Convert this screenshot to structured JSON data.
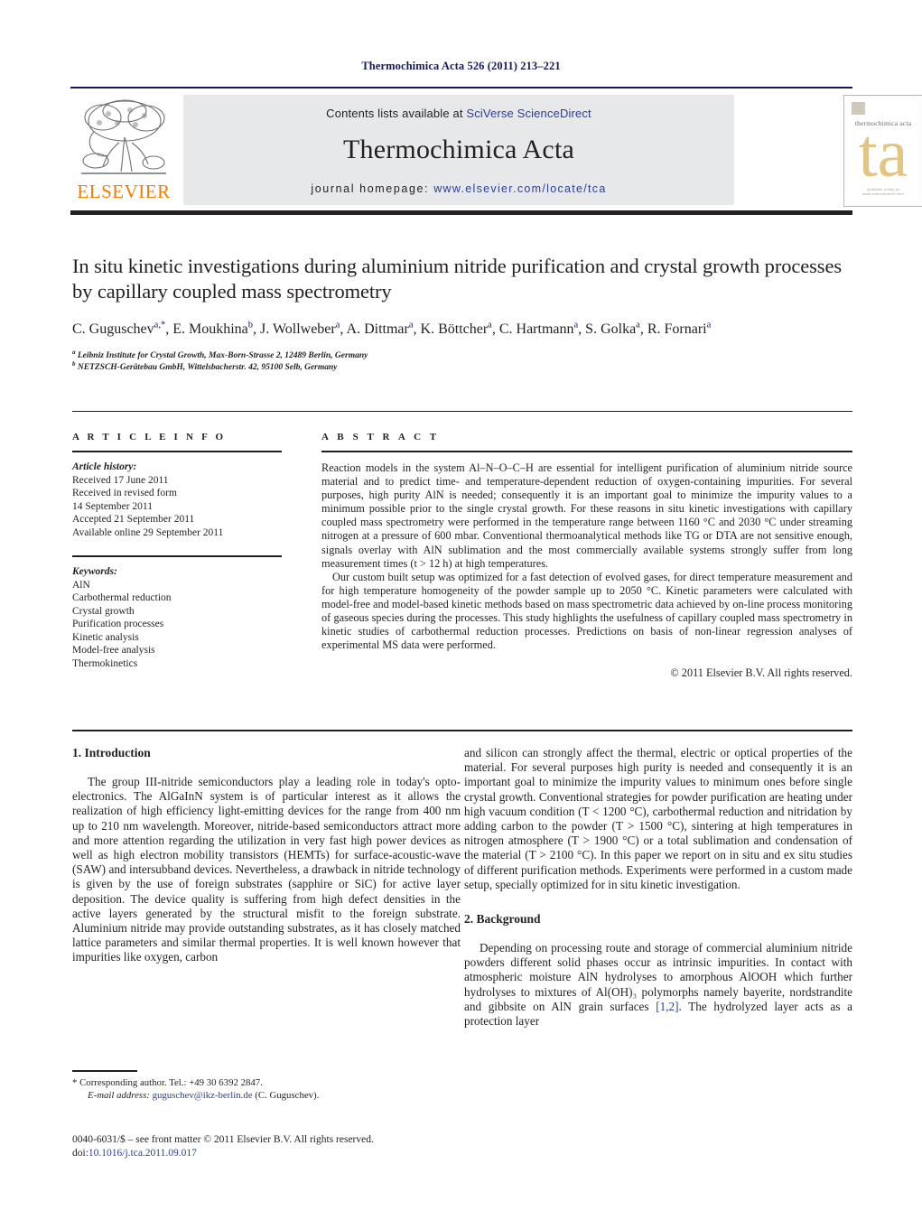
{
  "masthead": "Thermochimica Acta 526 (2011) 213–221",
  "header": {
    "publisher_name": "ELSEVIER",
    "contents_prefix": "Contents lists available at ",
    "contents_link": "SciVerse ScienceDirect",
    "journal_title": "Thermochimica Acta",
    "homepage_label": "journal homepage: ",
    "homepage_url": "www.elsevier.com/locate/tca",
    "cover_journal_name": "thermochimica acta",
    "cover_logo_text": "ta",
    "cover_footer": "available online at www.sciencedirect.com",
    "link_color": "#2b3f93",
    "rule_color": "#14195a",
    "gray_box_color": "#e7e8ea",
    "elsevier_orange": "#f07d00"
  },
  "article": {
    "title": "In situ kinetic investigations during aluminium nitride purification and crystal growth processes by capillary coupled mass spectrometry",
    "authors_line1": "C. Guguschev",
    "authors_html": "C. Guguschev<sup>a,*</sup>, E. Moukhina<sup>b</sup>, J. Wollweber<sup>a</sup>, A. Dittmar<sup>a</sup>, K. Böttcher<sup>a</sup>, C. Hartmann<sup>a</sup>, S. Golka<sup>a</sup>, R. Fornari<sup>a</sup>",
    "affiliation_a": "Leibniz Institute for Crystal Growth, Max-Born-Strasse 2, 12489 Berlin, Germany",
    "affiliation_b": "NETZSCH-Gerätebau GmbH, Wittelsbacherstr. 42, 95100 Selb, Germany"
  },
  "article_info": {
    "heading": "A R T I C L E  I N F O",
    "history_label": "Article history:",
    "history": [
      "Received 17 June 2011",
      "Received in revised form",
      "14 September 2011",
      "Accepted 21 September 2011",
      "Available online 29 September 2011"
    ],
    "keywords_label": "Keywords:",
    "keywords": [
      "AlN",
      "Carbothermal reduction",
      "Crystal growth",
      "Purification processes",
      "Kinetic analysis",
      "Model-free analysis",
      "Thermokinetics"
    ]
  },
  "abstract": {
    "heading": "A B S T R A C T",
    "paragraph1": "Reaction models in the system Al–N–O–C–H are essential for intelligent purification of aluminium nitride source material and to predict time- and temperature-dependent reduction of oxygen-containing impurities. For several purposes, high purity AlN is needed; consequently it is an important goal to minimize the impurity values to a minimum possible prior to the single crystal growth. For these reasons in situ kinetic investigations with capillary coupled mass spectrometry were performed in the temperature range between 1160 °C and 2030 °C under streaming nitrogen at a pressure of 600 mbar. Conventional thermoanalytical methods like TG or DTA are not sensitive enough, signals overlay with AlN sublimation and the most commercially available systems strongly suffer from long measurement times (t > 12 h) at high temperatures.",
    "paragraph2": "Our custom built setup was optimized for a fast detection of evolved gases, for direct temperature measurement and for high temperature homogeneity of the powder sample up to 2050 °C. Kinetic parameters were calculated with model-free and model-based kinetic methods based on mass spectrometric data achieved by on-line process monitoring of gaseous species during the processes. This study highlights the usefulness of capillary coupled mass spectrometry in kinetic studies of carbothermal reduction processes. Predictions on basis of non-linear regression analyses of experimental MS data were performed.",
    "copyright": "© 2011 Elsevier B.V. All rights reserved."
  },
  "body": {
    "section1_heading": "1.  Introduction",
    "section1_p1": "The group III-nitride semiconductors play a leading role in today's opto-electronics. The AlGaInN system is of particular interest as it allows the realization of high efficiency light-emitting devices for the range from 400 nm up to 210 nm wavelength. Moreover, nitride-based semiconductors attract more and more attention regarding the utilization in very fast high power devices as well as high electron mobility transistors (HEMTs) for surface-acoustic-wave (SAW) and intersubband devices. Nevertheless, a drawback in nitride technology is given by the use of foreign substrates (sapphire or SiC) for active layer deposition. The device quality is suffering from high defect densities in the active layers generated by the structural misfit to the foreign substrate. Aluminium nitride may provide outstanding substrates, as it has closely matched lattice parameters and similar thermal properties. It is well known however that impurities like oxygen, carbon",
    "section1_p1_cont": "and silicon can strongly affect the thermal, electric or optical properties of the material. For several purposes high purity is needed and consequently it is an important goal to minimize the impurity values to minimum ones before single crystal growth. Conventional strategies for powder purification are heating under high vacuum condition (T < 1200 °C), carbothermal reduction and nitridation by adding carbon to the powder (T > 1500 °C), sintering at high temperatures in nitrogen atmosphere (T > 1900 °C) or a total sublimation and condensation of the material (T > 2100 °C). In this paper we report on in situ and ex situ studies of different purification methods. Experiments were performed in a custom made setup, specially optimized for in situ kinetic investigation.",
    "section2_heading": "2.  Background",
    "section2_p1_a": "Depending on processing route and storage of commercial aluminium nitride powders different solid phases occur as intrinsic impurities. In contact with atmospheric moisture AlN hydrolyses to amorphous AlOOH which further hydrolyses to mixtures of Al(OH)₃ polymorphs namely bayerite, nordstrandite and gibbsite on AlN grain surfaces ",
    "section2_ref": "[1,2]",
    "section2_p1_b": ". The hydrolyzed layer acts as a protection layer"
  },
  "footnotes": {
    "corresponding": "* Corresponding author. Tel.: +49 30 6392 2847.",
    "email_label": "E-mail address:",
    "email": "guguschev@ikz-berlin.de",
    "email_suffix": "(C. Guguschev).",
    "colophon_line1": "0040-6031/$ – see front matter © 2011 Elsevier B.V. All rights reserved.",
    "colophon_doi_label": "doi:",
    "colophon_doi": "10.1016/j.tca.2011.09.017"
  }
}
